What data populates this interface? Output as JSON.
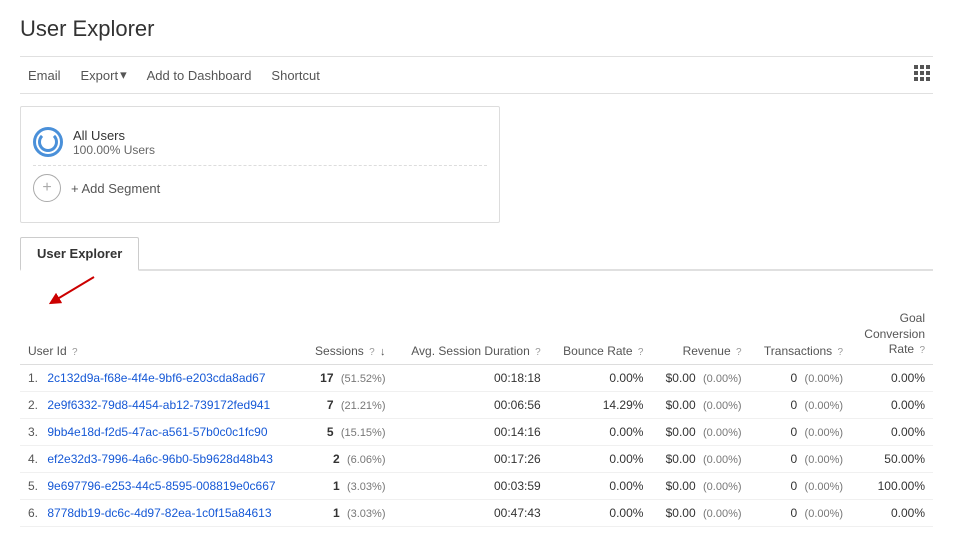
{
  "page": {
    "title": "User Explorer"
  },
  "toolbar": {
    "email_label": "Email",
    "export_label": "Export",
    "add_dashboard_label": "Add to Dashboard",
    "shortcut_label": "Shortcut"
  },
  "segments": {
    "all_users_label": "All Users",
    "all_users_pct": "100.00% Users",
    "add_segment_label": "+ Add Segment"
  },
  "tab": {
    "label": "User Explorer"
  },
  "table": {
    "headers": {
      "user_id": "User Id",
      "sessions": "Sessions",
      "avg_session": "Avg. Session Duration",
      "bounce_rate": "Bounce Rate",
      "revenue": "Revenue",
      "transactions": "Transactions",
      "goal_conversion": "Goal Conversion Rate"
    },
    "rows": [
      {
        "num": "1.",
        "user_id": "2c132d9a-f68e-4f4e-9bf6-e203cda8ad67",
        "sessions": "17",
        "sessions_pct": "51.52%",
        "avg_session": "00:18:18",
        "bounce_rate": "0.00%",
        "revenue": "$0.00",
        "revenue_pct": "0.00%",
        "transactions": "0",
        "transactions_pct": "0.00%",
        "goal_conversion": "0.00%"
      },
      {
        "num": "2.",
        "user_id": "2e9f6332-79d8-4454-ab12-739172fed941",
        "sessions": "7",
        "sessions_pct": "21.21%",
        "avg_session": "00:06:56",
        "bounce_rate": "14.29%",
        "revenue": "$0.00",
        "revenue_pct": "0.00%",
        "transactions": "0",
        "transactions_pct": "0.00%",
        "goal_conversion": "0.00%"
      },
      {
        "num": "3.",
        "user_id": "9bb4e18d-f2d5-47ac-a561-57b0c0c1fc90",
        "sessions": "5",
        "sessions_pct": "15.15%",
        "avg_session": "00:14:16",
        "bounce_rate": "0.00%",
        "revenue": "$0.00",
        "revenue_pct": "0.00%",
        "transactions": "0",
        "transactions_pct": "0.00%",
        "goal_conversion": "0.00%"
      },
      {
        "num": "4.",
        "user_id": "ef2e32d3-7996-4a6c-96b0-5b9628d48b43",
        "sessions": "2",
        "sessions_pct": "6.06%",
        "avg_session": "00:17:26",
        "bounce_rate": "0.00%",
        "revenue": "$0.00",
        "revenue_pct": "0.00%",
        "transactions": "0",
        "transactions_pct": "0.00%",
        "goal_conversion": "50.00%"
      },
      {
        "num": "5.",
        "user_id": "9e697796-e253-44c5-8595-008819e0c667",
        "sessions": "1",
        "sessions_pct": "3.03%",
        "avg_session": "00:03:59",
        "bounce_rate": "0.00%",
        "revenue": "$0.00",
        "revenue_pct": "0.00%",
        "transactions": "0",
        "transactions_pct": "0.00%",
        "goal_conversion": "100.00%"
      },
      {
        "num": "6.",
        "user_id": "8778db19-dc6c-4d97-82ea-1c0f15a84613",
        "sessions": "1",
        "sessions_pct": "3.03%",
        "avg_session": "00:47:43",
        "bounce_rate": "0.00%",
        "revenue": "$0.00",
        "revenue_pct": "0.00%",
        "transactions": "0",
        "transactions_pct": "0.00%",
        "goal_conversion": "0.00%"
      }
    ]
  }
}
